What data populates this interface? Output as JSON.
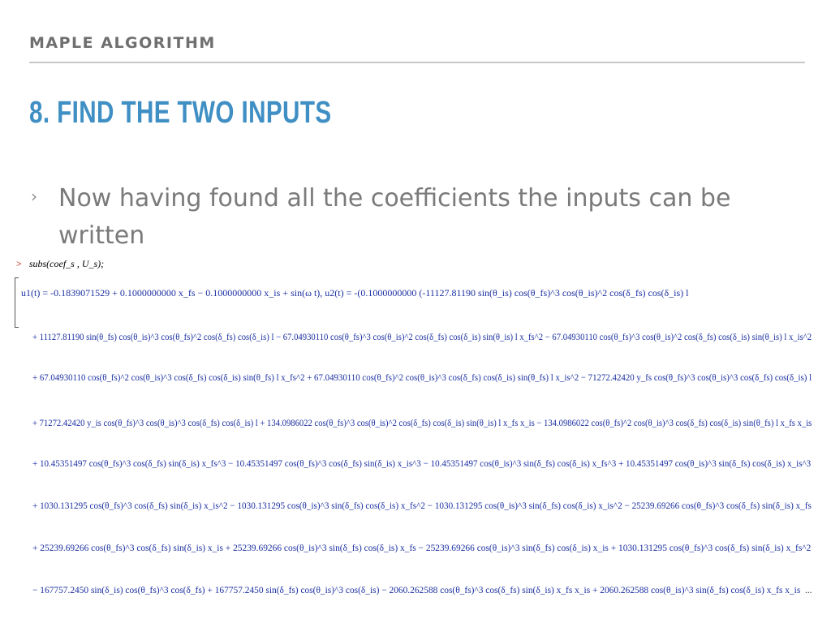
{
  "header": {
    "label": "MAPLE ALGORITHM"
  },
  "slide": {
    "title": "8. FIND THE TWO INPUTS"
  },
  "bullet": {
    "glyph": "›",
    "text": "Now having found all the coefficients the inputs can be written"
  },
  "maple": {
    "prompt": ">",
    "command": "subs(coef_s , U_s);",
    "lines": [
      "u1(t) = -0.1839071529 + 0.1000000000 x_fs − 0.1000000000 x_is + sin(ω t), u2(t) = -(0.1000000000 (-11127.81190 sin(θ_is) cos(θ_fs)^3 cos(θ_is)^2 cos(δ_fs) cos(δ_is) l",
      "+ 11127.81190 sin(θ_fs) cos(θ_is)^3 cos(θ_fs)^2 cos(δ_fs) cos(δ_is) l − 67.04930110 cos(θ_fs)^3 cos(θ_is)^2 cos(δ_fs) cos(δ_is) sin(θ_is) l x_fs^2 − 67.04930110 cos(θ_fs)^3 cos(θ_is)^2 cos(δ_fs) cos(δ_is) sin(θ_is) l x_is^2",
      "+ 67.04930110 cos(θ_fs)^2 cos(θ_is)^3 cos(δ_fs) cos(δ_is) sin(θ_fs) l x_fs^2 + 67.04930110 cos(θ_fs)^2 cos(θ_is)^3 cos(δ_fs) cos(δ_is) sin(θ_fs) l x_is^2 − 71272.42420 y_fs cos(θ_fs)^3 cos(θ_is)^3 cos(δ_fs) cos(δ_is) l",
      "+ 71272.42420 y_is cos(θ_fs)^3 cos(θ_is)^3 cos(δ_fs) cos(δ_is) l + 134.0986022 cos(θ_fs)^3 cos(θ_is)^2 cos(δ_fs) cos(δ_is) sin(θ_is) l x_fs x_is − 134.0986022 cos(θ_fs)^2 cos(θ_is)^3 cos(δ_fs) cos(δ_is) sin(θ_fs) l x_fs x_is",
      "+ 10.45351497 cos(θ_fs)^3 cos(δ_fs) sin(δ_is) x_fs^3 − 10.45351497 cos(θ_fs)^3 cos(δ_fs) sin(δ_is) x_is^3 − 10.45351497 cos(θ_is)^3 sin(δ_fs) cos(δ_is) x_fs^3 + 10.45351497 cos(θ_is)^3 sin(δ_fs) cos(δ_is) x_is^3",
      "+ 1030.131295 cos(θ_fs)^3 cos(δ_fs) sin(δ_is) x_is^2 − 1030.131295 cos(θ_is)^3 sin(δ_fs) cos(δ_is) x_fs^2 − 1030.131295 cos(θ_is)^3 sin(δ_fs) cos(δ_is) x_is^2 − 25239.69266 cos(θ_fs)^3 cos(δ_fs) sin(δ_is) x_fs",
      "+ 25239.69266 cos(θ_fs)^3 cos(δ_fs) sin(δ_is) x_is + 25239.69266 cos(θ_is)^3 sin(δ_fs) cos(δ_is) x_fs − 25239.69266 cos(θ_is)^3 sin(δ_fs) cos(δ_is) x_is + 1030.131295 cos(θ_fs)^3 cos(δ_fs) sin(δ_is) x_fs^2",
      "− 167757.2450 sin(δ_is) cos(θ_fs)^3 cos(δ_fs) + 167757.2450 sin(δ_fs) cos(θ_is)^3 cos(δ_is) − 2060.262588 cos(θ_fs)^3 cos(δ_fs) sin(δ_is) x_fs x_is + 2060.262588 cos(θ_is)^3 sin(δ_fs) cos(δ_is) x_fs x_is"
    ],
    "ellipsis": "..."
  }
}
